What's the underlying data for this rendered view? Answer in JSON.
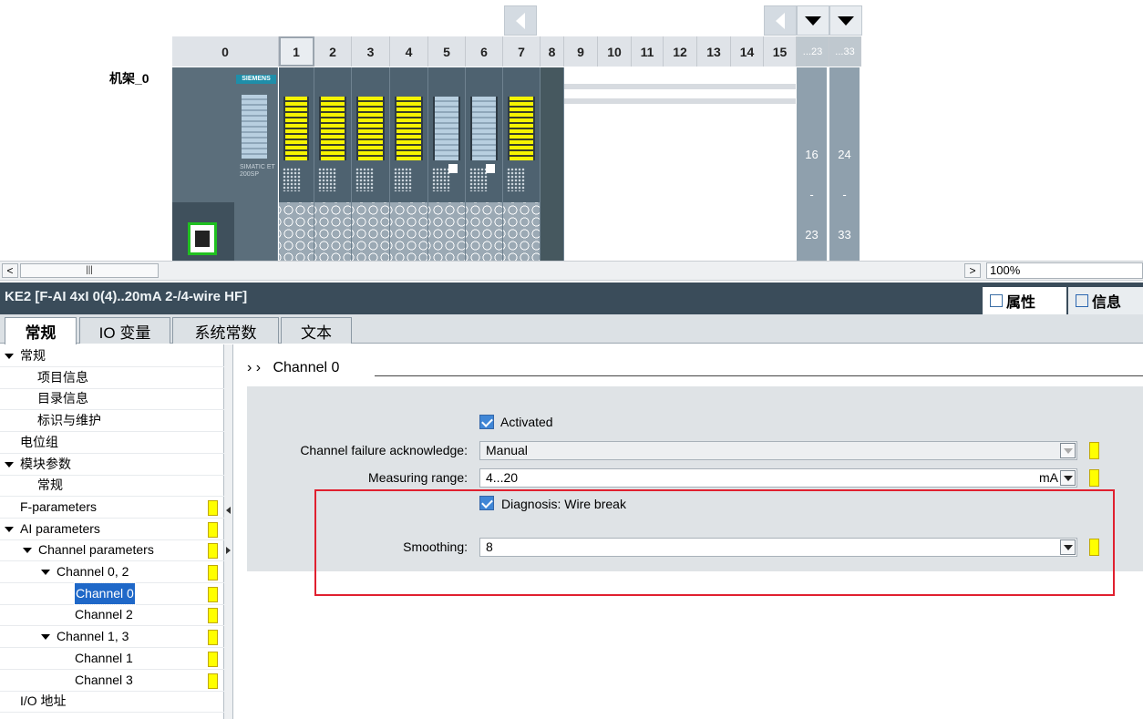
{
  "device_view": {
    "rack_label": "机架_0",
    "slots": [
      "0",
      "1",
      "2",
      "3",
      "4",
      "5",
      "6",
      "7",
      "8",
      "9",
      "10",
      "11",
      "12",
      "13",
      "14",
      "15",
      "...23",
      "...33"
    ],
    "extension_ranges": [
      [
        "16",
        "-",
        "23"
      ],
      [
        "24",
        "-",
        "33"
      ]
    ],
    "module_brand": "SIEMENS",
    "head_module_text": "SIMATIC ET 200SP"
  },
  "scrollbar": {
    "zoom": "100%"
  },
  "inspector": {
    "title": "KE2 [F-AI 4xI 0(4)..20mA 2-/4-wire HF]",
    "tabs": {
      "properties": "属性",
      "info": "信息"
    }
  },
  "property_tabs": [
    "常规",
    "IO 变量",
    "系统常数",
    "文本"
  ],
  "nav": {
    "items": [
      {
        "label": "常规",
        "indent": 0,
        "arrow": true,
        "flag": false,
        "selected": false
      },
      {
        "label": "项目信息",
        "indent": 2,
        "arrow": false,
        "flag": false,
        "selected": false
      },
      {
        "label": "目录信息",
        "indent": 2,
        "arrow": false,
        "flag": false,
        "selected": false
      },
      {
        "label": "标识与维护",
        "indent": 2,
        "arrow": false,
        "flag": false,
        "selected": false
      },
      {
        "label": "电位组",
        "indent": 0,
        "arrow": false,
        "flag": false,
        "selected": false
      },
      {
        "label": "模块参数",
        "indent": 0,
        "arrow": true,
        "flag": false,
        "selected": false
      },
      {
        "label": "常规",
        "indent": 2,
        "arrow": false,
        "flag": false,
        "selected": false
      },
      {
        "label": "F-parameters",
        "indent": 1,
        "arrow": false,
        "flag": true,
        "selected": false
      },
      {
        "label": "AI parameters",
        "indent": 0,
        "arrow": true,
        "flag": true,
        "selected": false
      },
      {
        "label": "Channel parameters",
        "indent": 1,
        "arrow": true,
        "flag": true,
        "selected": false
      },
      {
        "label": "Channel 0, 2",
        "indent": 2,
        "arrow": true,
        "flag": true,
        "selected": false
      },
      {
        "label": "Channel 0",
        "indent": 4,
        "arrow": false,
        "flag": true,
        "selected": true
      },
      {
        "label": "Channel 2",
        "indent": 4,
        "arrow": false,
        "flag": true,
        "selected": false
      },
      {
        "label": "Channel 1, 3",
        "indent": 2,
        "arrow": true,
        "flag": true,
        "selected": false
      },
      {
        "label": "Channel 1",
        "indent": 4,
        "arrow": false,
        "flag": true,
        "selected": false
      },
      {
        "label": "Channel 3",
        "indent": 4,
        "arrow": false,
        "flag": true,
        "selected": false
      },
      {
        "label": "I/O 地址",
        "indent": 1,
        "arrow": false,
        "flag": false,
        "selected": false
      }
    ]
  },
  "content": {
    "breadcrumb": "Channel 0",
    "activated_label": "Activated",
    "failure_ack_label": "Channel failure acknowledge:",
    "failure_ack_value": "Manual",
    "measuring_range_label": "Measuring range:",
    "measuring_range_value": "4...20",
    "measuring_range_unit": "mA",
    "diagnosis_label": "Diagnosis: Wire break",
    "smoothing_label": "Smoothing:",
    "smoothing_value": "8"
  },
  "colors": {
    "flag": "#ffff00",
    "highlight": "#e0202f",
    "selection": "#1f68c8"
  }
}
